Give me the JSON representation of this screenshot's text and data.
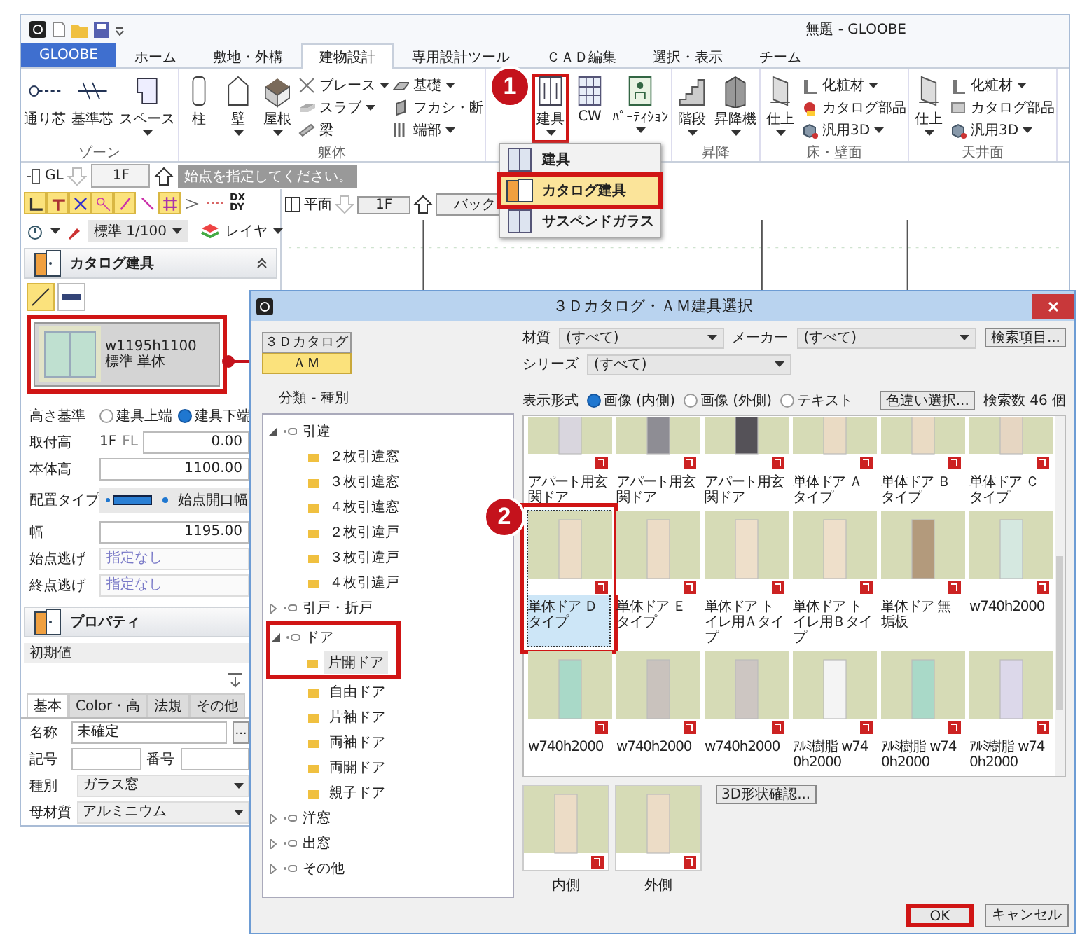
{
  "main_window": {
    "title": "無題 - GLOOBE",
    "tabs": [
      {
        "label": "GLOOBE",
        "kind": "app",
        "selected": false
      },
      {
        "label": "ホーム",
        "kind": "tab",
        "selected": false
      },
      {
        "label": "敷地・外構",
        "kind": "tab",
        "selected": false
      },
      {
        "label": "建物設計",
        "kind": "tab",
        "selected": true
      },
      {
        "label": "専用設計ツール",
        "kind": "tab",
        "selected": false
      },
      {
        "label": "ＣＡＤ編集",
        "kind": "tab",
        "selected": false
      },
      {
        "label": "選択・表示",
        "kind": "tab",
        "selected": false
      },
      {
        "label": "チーム",
        "kind": "tab",
        "selected": false
      }
    ],
    "ribbon_groups": [
      {
        "label": "ゾーン",
        "items": [
          {
            "kind": "large",
            "label": "通り芯",
            "menu": false,
            "highlighted": false
          },
          {
            "kind": "large",
            "label": "基準芯",
            "menu": false,
            "highlighted": false
          },
          {
            "kind": "large",
            "label": "スペース",
            "menu": true,
            "highlighted": false
          }
        ]
      },
      {
        "label": "躯体",
        "items": [
          {
            "kind": "large",
            "label": "柱",
            "menu": false,
            "highlighted": false
          },
          {
            "kind": "large",
            "label": "壁",
            "menu": true,
            "highlighted": false
          },
          {
            "kind": "large",
            "label": "屋根",
            "menu": true,
            "highlighted": false
          },
          {
            "kind": "small",
            "label": "ブレース",
            "menu": true,
            "highlighted": false
          },
          {
            "kind": "small",
            "label": "スラブ",
            "menu": true,
            "highlighted": false
          },
          {
            "kind": "small",
            "label": "梁",
            "menu": false,
            "highlighted": false
          },
          {
            "kind": "small",
            "label": "基礎",
            "menu": true,
            "highlighted": false
          },
          {
            "kind": "small",
            "label": "フカシ・断",
            "menu": false,
            "highlighted": false
          },
          {
            "kind": "small",
            "label": "端部",
            "menu": true,
            "highlighted": false
          }
        ]
      },
      {
        "items": [
          {
            "kind": "large",
            "label": "建具",
            "menu": true,
            "highlighted": true
          },
          {
            "kind": "large",
            "label": "CW",
            "menu": false,
            "highlighted": false
          },
          {
            "kind": "large",
            "label": "ﾊﾟｰﾃｨｼｮﾝ",
            "menu": true,
            "highlighted": false
          }
        ]
      },
      {
        "label": "昇降",
        "items": [
          {
            "kind": "large",
            "label": "階段",
            "menu": true,
            "highlighted": false
          },
          {
            "kind": "large",
            "label": "昇降機",
            "menu": true,
            "highlighted": false
          }
        ]
      },
      {
        "label": "床・壁面",
        "items": [
          {
            "kind": "large",
            "label": "仕上",
            "menu": true,
            "highlighted": false
          },
          {
            "kind": "small",
            "label": "化粧材",
            "menu": true,
            "highlighted": false
          },
          {
            "kind": "small",
            "label": "カタログ部品",
            "menu": false,
            "highlighted": false
          },
          {
            "kind": "small",
            "label": "汎用3D",
            "menu": true,
            "highlighted": false
          }
        ]
      },
      {
        "label": "天井面",
        "items": [
          {
            "kind": "large",
            "label": "仕上",
            "menu": true,
            "highlighted": false
          },
          {
            "kind": "small",
            "label": "化粧材",
            "menu": true,
            "highlighted": false
          },
          {
            "kind": "small",
            "label": "カタログ部品",
            "menu": false,
            "highlighted": false
          },
          {
            "kind": "small",
            "label": "汎用3D",
            "menu": true,
            "highlighted": false
          }
        ]
      }
    ]
  },
  "toolbar": {
    "level": "GL",
    "floor": "1F",
    "hint": "始点を指定してください。"
  },
  "snap_tools": [
    {
      "on": true
    },
    {
      "on": true
    },
    {
      "on": true
    },
    {
      "on": true
    },
    {
      "on": true
    },
    {
      "on": false
    },
    {
      "on": true
    },
    {
      "on": false
    },
    {
      "on": false
    }
  ],
  "offset_button": [
    "DX",
    "DY"
  ],
  "scale": "標準 1/100",
  "layer_button": "レイヤ",
  "plan_view": {
    "label": "平面",
    "floor": "1F",
    "back": "バック"
  },
  "catalog_panel": {
    "title": "カタログ建具",
    "placement_modes": [
      {
        "selected": true
      },
      {
        "selected": false
      }
    ],
    "preview": {
      "line1": "w1195h1100",
      "line2": "標準 単体",
      "highlighted": true
    },
    "height_ref": {
      "label": "高さ基準",
      "options": [
        {
          "label": "建具上端",
          "selected": false
        },
        {
          "label": "建具下端",
          "selected": true
        }
      ]
    },
    "fields": [
      {
        "kind": "number",
        "label": "取付高",
        "prefix": "1F",
        "unit": "FL",
        "value": "0.00"
      },
      {
        "kind": "number",
        "label": "本体高",
        "value": "1100.00"
      },
      {
        "kind": "placement",
        "label": "配置タイプ",
        "value": "始点開口幅"
      },
      {
        "kind": "number",
        "label": "幅",
        "value": "1195.00"
      },
      {
        "kind": "select",
        "label": "始点逃げ",
        "value": "指定なし"
      },
      {
        "kind": "select",
        "label": "終点逃げ",
        "value": "指定なし"
      }
    ]
  },
  "properties_panel": {
    "title": "プロパティ",
    "preset": "初期値",
    "tabs": [
      {
        "label": "基本",
        "selected": true
      },
      {
        "label": "Color・高",
        "selected": false
      },
      {
        "label": "法規",
        "selected": false
      },
      {
        "label": "その他",
        "selected": false
      }
    ],
    "rows": [
      {
        "kind": "text",
        "label": "名称",
        "value": "未確定",
        "button": "..."
      },
      {
        "kind": "pair",
        "label": "記号",
        "label2": "番号"
      },
      {
        "kind": "select",
        "label": "種別",
        "value": "ガラス窓"
      },
      {
        "kind": "select",
        "label": "母材質",
        "value": "アルミニウム"
      }
    ]
  },
  "menu": {
    "items": [
      {
        "label": "建具",
        "selected": false,
        "highlighted": false
      },
      {
        "label": "カタログ建具",
        "selected": true,
        "highlighted": true
      },
      {
        "label": "サスペンドガラス",
        "selected": false,
        "highlighted": false
      }
    ]
  },
  "dialog": {
    "title": "３Ｄカタログ・ＡＭ建具選択",
    "sources": [
      {
        "label": "３Ｄカタログ",
        "selected": false
      },
      {
        "label": "ＡＭ",
        "selected": true
      }
    ],
    "tree_label": "分類 - 種別",
    "tree": [
      {
        "label": "引違",
        "expanded": true,
        "highlighted": false,
        "children": [
          {
            "label": "２枚引違窓",
            "selected": false
          },
          {
            "label": "３枚引違窓",
            "selected": false
          },
          {
            "label": "４枚引違窓",
            "selected": false
          },
          {
            "label": "２枚引違戸",
            "selected": false
          },
          {
            "label": "３枚引違戸",
            "selected": false
          },
          {
            "label": "４枚引違戸",
            "selected": false
          }
        ]
      },
      {
        "label": "引戸・折戸",
        "expanded": false,
        "highlighted": false
      },
      {
        "label": "ドア",
        "expanded": true,
        "highlighted": true,
        "children": [
          {
            "label": "片開ドア",
            "selected": true
          },
          {
            "label": "自由ドア",
            "selected": false
          },
          {
            "label": "片袖ドア",
            "selected": false
          },
          {
            "label": "両袖ドア",
            "selected": false
          },
          {
            "label": "両開ドア",
            "selected": false
          },
          {
            "label": "親子ドア",
            "selected": false
          }
        ]
      },
      {
        "label": "洋窓",
        "expanded": false,
        "highlighted": false
      },
      {
        "label": "出窓",
        "expanded": false,
        "highlighted": false
      },
      {
        "label": "その他",
        "expanded": false,
        "highlighted": false
      }
    ],
    "filters": [
      {
        "label": "材質",
        "value": "(すべて)"
      },
      {
        "label": "メーカー",
        "value": "(すべて)"
      },
      {
        "label": "シリーズ",
        "value": "(すべて)"
      }
    ],
    "search_button": "検索項目...",
    "display": {
      "label": "表示形式",
      "options": [
        {
          "label": "画像 (内側)",
          "selected": true
        },
        {
          "label": "画像 (外側)",
          "selected": false
        },
        {
          "label": "テキスト",
          "selected": false
        }
      ]
    },
    "color_button": "色違い選択...",
    "count": "検索数 46 個",
    "grid": {
      "rows": [
        [
          {
            "label": "アパート用玄関ドア",
            "color": "#d9d6de",
            "selected": false,
            "highlighted": false
          },
          {
            "label": "アパート用玄関ドア",
            "color": "#8e8d94",
            "selected": false,
            "highlighted": false
          },
          {
            "label": "アパート用玄関ドア",
            "color": "#555258",
            "selected": false,
            "highlighted": false
          },
          {
            "label": "単体ドア Ａタイプ",
            "color": "#eadbc4",
            "selected": false,
            "highlighted": false
          },
          {
            "label": "単体ドア Ｂタイプ",
            "color": "#eadbc4",
            "selected": false,
            "highlighted": false
          },
          {
            "label": "単体ドア Ｃタイプ",
            "color": "#e6d6c2",
            "selected": false,
            "highlighted": false
          }
        ],
        [
          {
            "label": "単体ドア Ｄタイプ",
            "color": "#ecdcc6",
            "selected": true,
            "highlighted": true
          },
          {
            "label": "単体ドア Ｅタイプ",
            "color": "#ecdcc6",
            "selected": false,
            "highlighted": false
          },
          {
            "label": "単体ドア トイレ用Ａタイプ",
            "color": "#eedfca",
            "selected": false,
            "highlighted": false
          },
          {
            "label": "単体ドア トイレ用Ｂタイプ",
            "color": "#eedfca",
            "selected": false,
            "highlighted": false
          },
          {
            "label": "単体ドア 無垢板",
            "color": "#b39a7c",
            "selected": false,
            "highlighted": false
          },
          {
            "label": "w740h2000",
            "color": "#d5e8e0",
            "selected": false,
            "highlighted": false
          }
        ],
        [
          {
            "label": "w740h2000",
            "color": "#a9d9c8",
            "selected": false,
            "highlighted": false
          },
          {
            "label": "w740h2000",
            "color": "#c9c2bd",
            "selected": false,
            "highlighted": false
          },
          {
            "label": "w740h2000",
            "color": "#cdc6c2",
            "selected": false,
            "highlighted": false
          },
          {
            "label": "ｱﾙﾐ樹脂 w740h2000",
            "color": "#f4f4f4",
            "selected": false,
            "highlighted": false
          },
          {
            "label": "ｱﾙﾐ樹脂 w740h2000",
            "color": "#a9d9c8",
            "selected": false,
            "highlighted": false
          },
          {
            "label": "ｱﾙﾐ樹脂 w740h2000",
            "color": "#dcd8ea",
            "selected": false,
            "highlighted": false
          }
        ]
      ]
    },
    "previews": [
      {
        "label": "内側"
      },
      {
        "label": "外側"
      }
    ],
    "shape_button": "3D形状確認...",
    "buttons": [
      {
        "label": "OK",
        "highlighted": true
      },
      {
        "label": "キャンセル",
        "highlighted": false
      }
    ]
  },
  "callouts": [
    {
      "number": "1"
    },
    {
      "number": "2"
    }
  ]
}
